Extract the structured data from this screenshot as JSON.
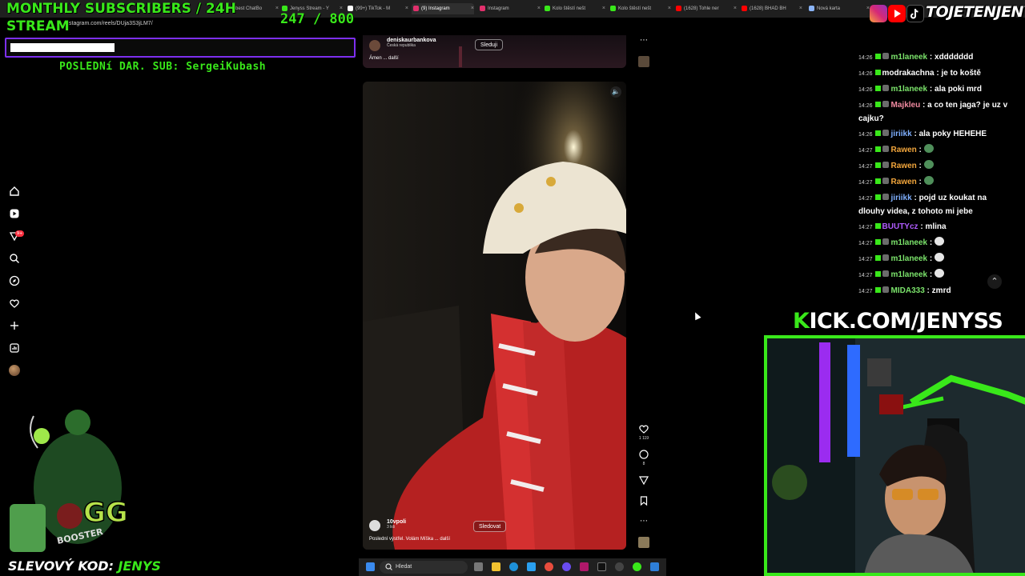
{
  "browser": {
    "tabs": [
      {
        "label": "The best ChatBo",
        "color": "#6b6b6b"
      },
      {
        "label": "Jenyss Stream - Y",
        "color": "#39e81a"
      },
      {
        "label": "(99+) TikTok - M",
        "color": "#ffffff"
      },
      {
        "label": "(9) Instagram",
        "color": "#e1306c"
      },
      {
        "label": "Instagram",
        "color": "#e1306c"
      },
      {
        "label": "Kolo štěstí nešt",
        "color": "#39e81a"
      },
      {
        "label": "Kolo štěstí nešt",
        "color": "#39e81a"
      },
      {
        "label": "(1628) Tohle ner",
        "color": "#ff0000"
      },
      {
        "label": "(1628) BHAD BH",
        "color": "#ff0000"
      },
      {
        "label": "Nová karta",
        "color": "#8ab4f8"
      }
    ],
    "url": "stagram.com/reels/DUja3S3jLM7/"
  },
  "overlay": {
    "title_line1": "MONTHLY SUBSCRIBERS / 24H",
    "title_line2": "STREAM",
    "counter": "247 / 800",
    "subgoal_progress": 0.3,
    "last_sub": "POSLEDNí DAR. SUB: SergeiKubash",
    "promo_prefix": "SLEVOVÝ KOD: ",
    "promo_code": "JENYS",
    "brand": "TOJETENJENYS",
    "kick_prefix": "K",
    "kick_rest": "ICK.COM/JENYSS",
    "accent": "#39e81a",
    "frame_purple": "#7d2ff0"
  },
  "sidebar": {
    "icons": [
      "home-icon",
      "reels-icon",
      "messages-icon",
      "search-icon",
      "explore-icon",
      "heart-icon",
      "create-icon",
      "dashboard-icon",
      "profile-icon"
    ],
    "badge": "9+"
  },
  "reel_top": {
    "author": "deniskaurbankova",
    "location": "Česká republika",
    "follow_label": "Sleduji",
    "caption": "Ámen ... další"
  },
  "reel_main": {
    "author": "10vpoli",
    "followers": "3 lidi",
    "follow_label": "Sledovat",
    "caption": "Poslední výstřel. Volám Míška ... další",
    "likes": "1 119",
    "comments": "8"
  },
  "chat": {
    "messages": [
      {
        "time": "14:26",
        "user": "m1laneek",
        "color": "#7be36b",
        "text": "xddddddd",
        "badge": true
      },
      {
        "time": "14:26",
        "user": "modrakachna",
        "color": "#ffffff",
        "text": "je to koště",
        "badge": false
      },
      {
        "time": "14:26",
        "user": "m1laneek",
        "color": "#7be36b",
        "text": "ala poki mrd",
        "badge": true
      },
      {
        "time": "14:26",
        "user": "Majkleu",
        "color": "#f08aa0",
        "text": "a co ten jaga? je uz v cajku?",
        "badge": true
      },
      {
        "time": "14:26",
        "user": "jiriikk",
        "color": "#7fb0ff",
        "text": "ala poky HEHEHE",
        "badge": true
      },
      {
        "time": "14:27",
        "user": "Rawen",
        "color": "#f2a63c",
        "text": "",
        "badge": true,
        "emote": "#4f8f5a"
      },
      {
        "time": "14:27",
        "user": "Rawen",
        "color": "#f2a63c",
        "text": "",
        "badge": true,
        "emote": "#4f8f5a"
      },
      {
        "time": "14:27",
        "user": "Rawen",
        "color": "#f2a63c",
        "text": "",
        "badge": true,
        "emote": "#4f8f5a"
      },
      {
        "time": "14:27",
        "user": "jiriikk",
        "color": "#7fb0ff",
        "text": "pojd uz koukat na dlouhy videa, z tohoto mi jebe",
        "badge": true
      },
      {
        "time": "14:27",
        "user": "BUUTYcz",
        "color": "#b05cff",
        "text": "mlina",
        "badge": false
      },
      {
        "time": "14:27",
        "user": "m1laneek",
        "color": "#7be36b",
        "text": "",
        "badge": true,
        "emote": "#e6e6e6"
      },
      {
        "time": "14:27",
        "user": "m1laneek",
        "color": "#7be36b",
        "text": "",
        "badge": true,
        "emote": "#e6e6e6"
      },
      {
        "time": "14:27",
        "user": "m1laneek",
        "color": "#7be36b",
        "text": "",
        "badge": true,
        "emote": "#e6e6e6"
      },
      {
        "time": "14:27",
        "user": "MIDA333",
        "color": "#7be36b",
        "text": "zmrd",
        "badge": true
      }
    ]
  },
  "taskbar": {
    "search_placeholder": "Hledat"
  }
}
